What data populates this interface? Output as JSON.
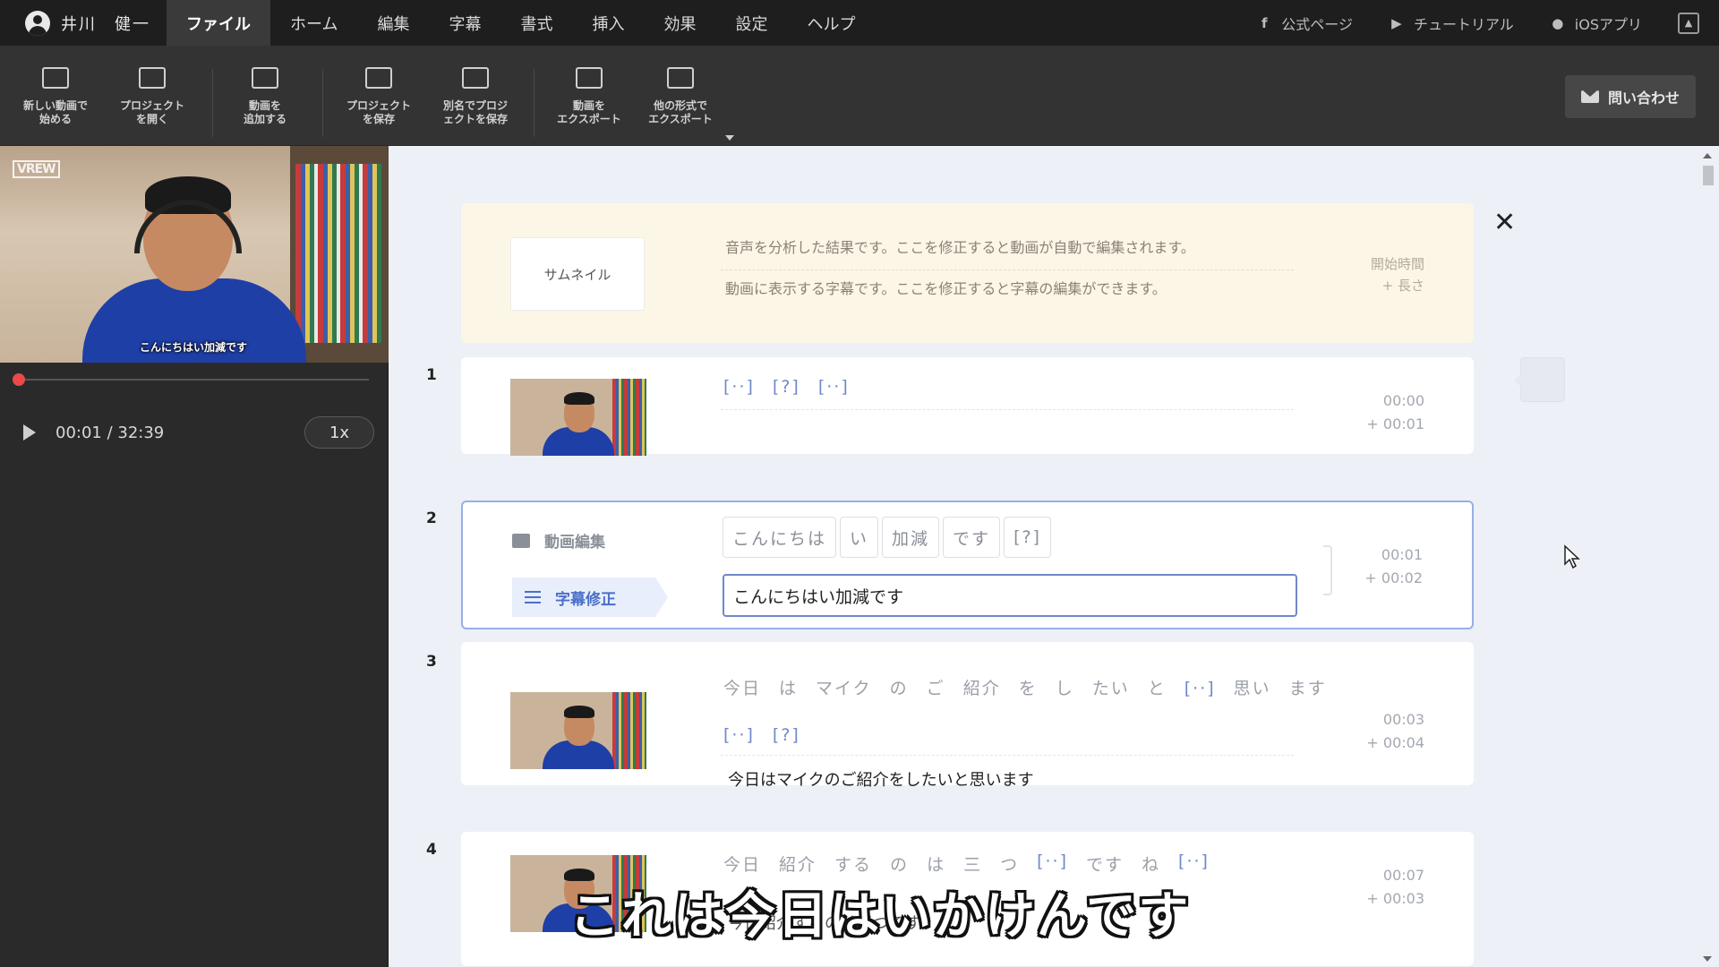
{
  "user": {
    "name": "井川　健一"
  },
  "menu": [
    {
      "label": "ファイル",
      "active": true
    },
    {
      "label": "ホーム"
    },
    {
      "label": "編集"
    },
    {
      "label": "字幕"
    },
    {
      "label": "書式"
    },
    {
      "label": "挿入"
    },
    {
      "label": "効果"
    },
    {
      "label": "設定"
    },
    {
      "label": "ヘルプ"
    }
  ],
  "links": {
    "official": "公式ページ",
    "tutorial": "チュートリアル",
    "ios": "iOSアプリ"
  },
  "toolbar": {
    "new_video": "新しい動画で\n始める",
    "open_project": "プロジェクト\nを開く",
    "add_video": "動画を\n追加する",
    "save_project": "プロジェクト\nを保存",
    "save_as": "別名でプロジ\nェクトを保存",
    "export_video": "動画を\nエクスポート",
    "export_other": "他の形式で\nエクスポート",
    "contact": "問い合わせ"
  },
  "player": {
    "watermark": "VREW",
    "video_caption": "こんにちはい加減です",
    "time": "00:01 / 32:39",
    "speed": "1x",
    "progress": 0.0005
  },
  "header": {
    "thumbnail_label": "サムネイル",
    "line1": "音声を分析した結果です。ここを修正すると動画が自動で編集されます。",
    "line2": "動画に表示する字幕です。ここを修正すると字幕の編集ができます。",
    "start_label": "開始時間",
    "length_label": "+ 長さ"
  },
  "rows": [
    {
      "num": "1",
      "words": [
        "[··]",
        "[?]",
        "[··]"
      ],
      "start": "00:00",
      "length": "+ 00:01"
    },
    {
      "num": "2",
      "mode_edit": "動画編集",
      "mode_sub": "字幕修正",
      "chips": [
        "こんにちは",
        "い",
        "加減",
        "です",
        "[?]"
      ],
      "subtitle": "こんにちはい加減です",
      "start": "00:01",
      "length": "+ 00:02"
    },
    {
      "num": "3",
      "words": [
        "今日",
        "は",
        "マイク",
        "の",
        "ご",
        "紹介",
        "を",
        "し",
        "たい",
        "と",
        "[··]",
        "思い",
        "ます",
        "[··]",
        "[?]"
      ],
      "subtitle": "今日はマイクのご紹介をしたいと思います",
      "start": "00:03",
      "length": "+ 00:04"
    },
    {
      "num": "4",
      "words": [
        "今日",
        "紹介",
        "する",
        "の",
        "は",
        "三",
        "つ",
        "[··]",
        "です",
        "ね",
        "[··]"
      ],
      "subtitle": "今日紹介するのは三つです",
      "start": "00:07",
      "length": "+ 00:03"
    }
  ],
  "overlay_caption": "これは今日はいかけんです",
  "colors": {
    "accent": "#6f88c9",
    "record": "#e84a4a",
    "header_bg": "#fcf6e6"
  }
}
